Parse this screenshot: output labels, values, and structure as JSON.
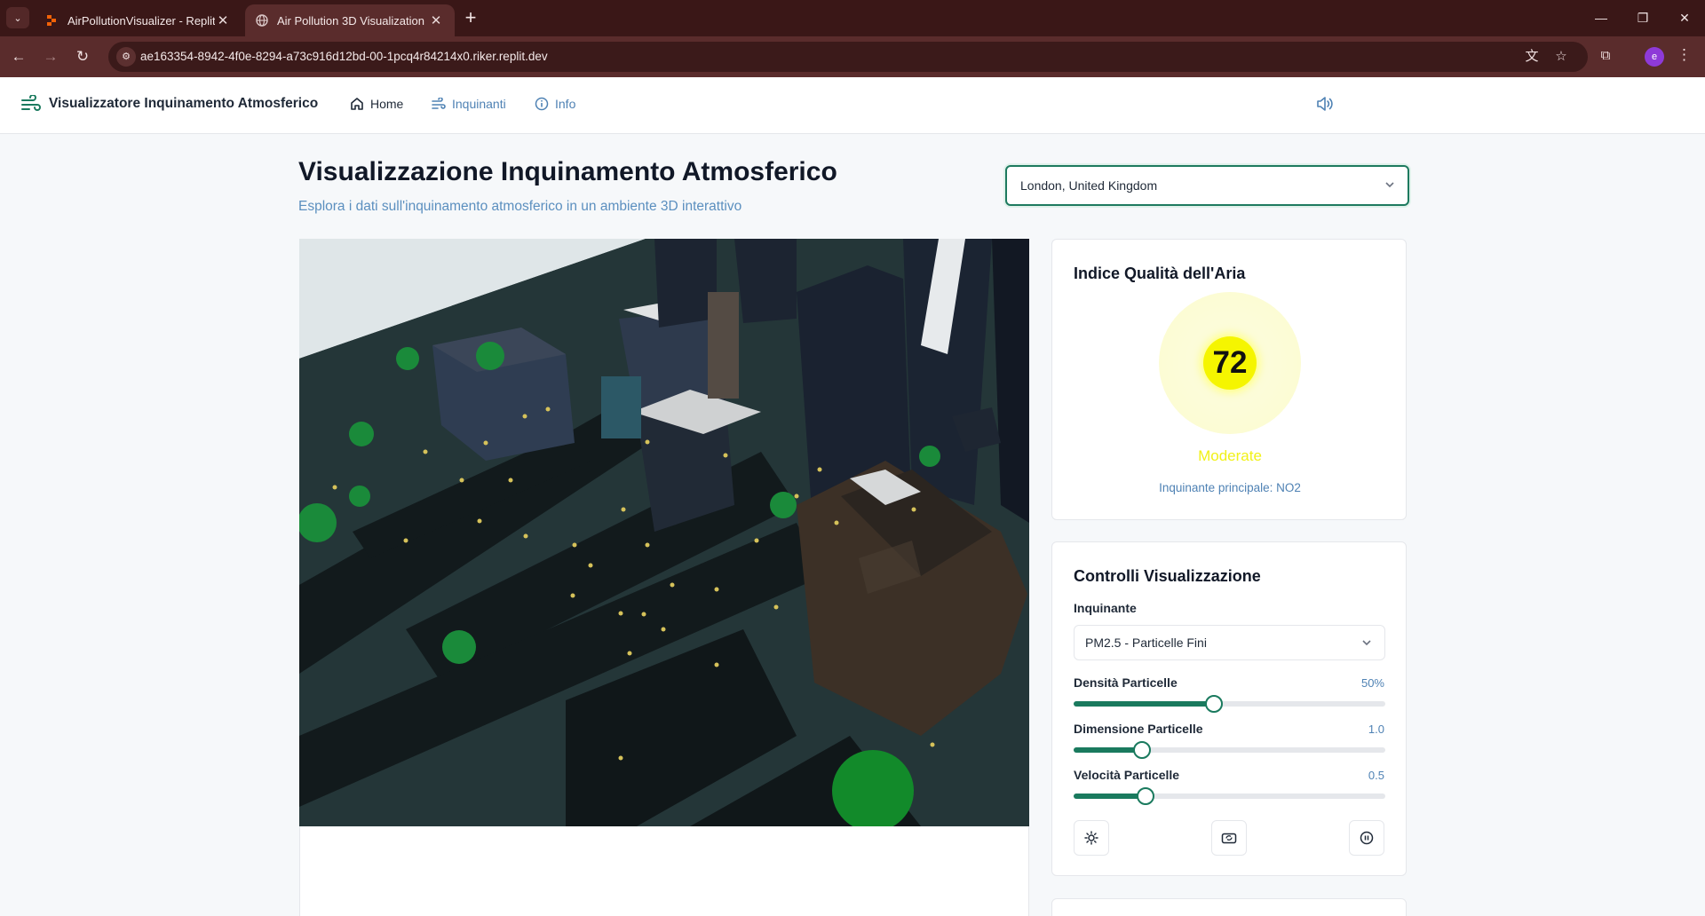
{
  "browser": {
    "tabs": [
      {
        "title": "AirPollutionVisualizer - Replit",
        "active": false
      },
      {
        "title": "Air Pollution 3D Visualization",
        "active": true
      }
    ],
    "url": "ae163354-8942-4f0e-8294-a73c916d12bd-00-1pcq4r84214x0.riker.replit.dev",
    "profile_initial": "e"
  },
  "header": {
    "brand": "Visualizzatore Inquinamento Atmosferico",
    "nav": {
      "home": "Home",
      "pollutants": "Inquinanti",
      "info": "Info"
    }
  },
  "main": {
    "title": "Visualizzazione Inquinamento Atmosferico",
    "subtitle": "Esplora i dati sull'inquinamento atmosferico in un ambiente 3D interattivo",
    "city": "London, United Kingdom"
  },
  "aqi": {
    "title": "Indice Qualità dell'Aria",
    "value": "72",
    "status": "Moderate",
    "main_pollutant": "Inquinante principale: NO2",
    "color": "#f5f500"
  },
  "controls": {
    "title": "Controlli Visualizzazione",
    "pollutant_label": "Inquinante",
    "pollutant_value": "PM2.5 - Particelle Fini",
    "density": {
      "label": "Densità Particelle",
      "value": "50%",
      "fraction": 0.45
    },
    "size": {
      "label": "Dimensione Particelle",
      "value": "1.0",
      "fraction": 0.22
    },
    "speed": {
      "label": "Velocità Particelle",
      "value": "0.5",
      "fraction": 0.23
    }
  },
  "colors": {
    "accent": "#1a7a5e",
    "link": "#4f82b4"
  }
}
